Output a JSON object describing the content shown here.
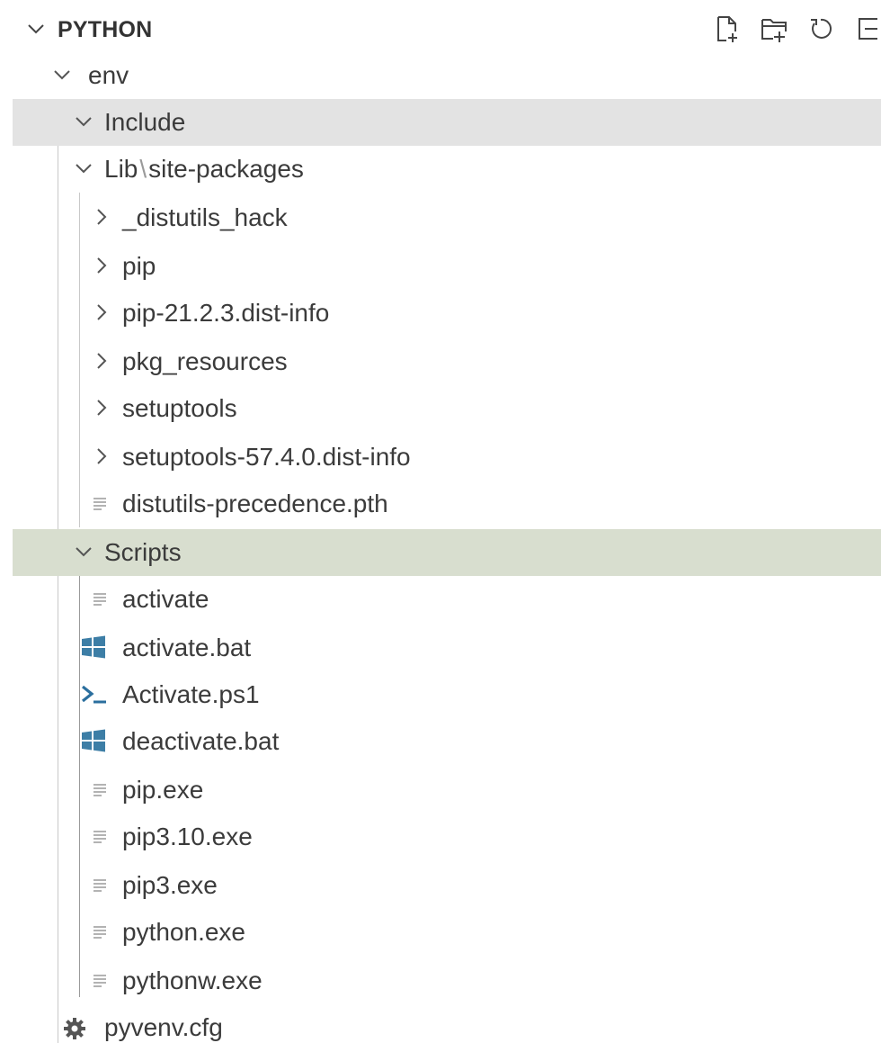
{
  "explorer": {
    "title": "PYTHON",
    "actions": [
      {
        "name": "new-file-icon",
        "title": "New File"
      },
      {
        "name": "new-folder-icon",
        "title": "New Folder"
      },
      {
        "name": "refresh-icon",
        "title": "Refresh Explorer"
      },
      {
        "name": "collapse-all-icon",
        "title": "Collapse Folders in Explorer"
      }
    ],
    "tree": {
      "env": "env",
      "include": "Include",
      "lib": "Lib",
      "lib_sep": "\\",
      "site_packages": "site-packages",
      "lib_children": [
        "_distutils_hack",
        "pip",
        "pip-21.2.3.dist-info",
        "pkg_resources",
        "setuptools",
        "setuptools-57.4.0.dist-info"
      ],
      "lib_file": "distutils-precedence.pth",
      "scripts": "Scripts",
      "scripts_children": [
        {
          "label": "activate",
          "icon": "text-file-icon"
        },
        {
          "label": "activate.bat",
          "icon": "windows-icon"
        },
        {
          "label": "Activate.ps1",
          "icon": "powershell-icon"
        },
        {
          "label": "deactivate.bat",
          "icon": "windows-icon"
        },
        {
          "label": "pip.exe",
          "icon": "text-file-icon"
        },
        {
          "label": "pip3.10.exe",
          "icon": "text-file-icon"
        },
        {
          "label": "pip3.exe",
          "icon": "text-file-icon"
        },
        {
          "label": "python.exe",
          "icon": "text-file-icon"
        },
        {
          "label": "pythonw.exe",
          "icon": "text-file-icon"
        }
      ],
      "cfg": "pyvenv.cfg"
    },
    "colors": {
      "windows_icon": "#3d7ea6",
      "powershell_icon": "#2b6f9e",
      "selected_row": "#e3e3e3",
      "selected_row_scripts": "#d8decf"
    }
  }
}
